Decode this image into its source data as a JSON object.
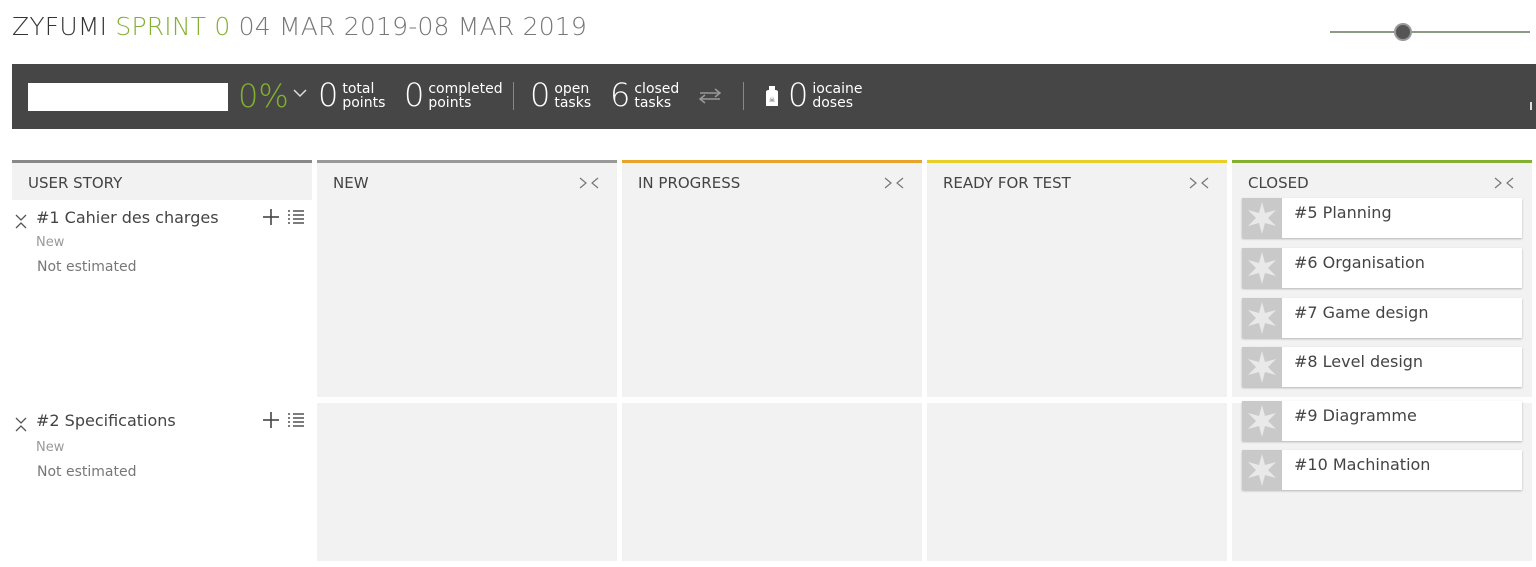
{
  "header": {
    "project": "ZYFUMI",
    "sprint": "SPRINT 0",
    "dates": "04 MAR 2019-08 MAR 2019"
  },
  "zoom": {
    "level": 0.35
  },
  "stats": {
    "progress": "0%",
    "total_points": {
      "value": "0",
      "label1": "total",
      "label2": "points"
    },
    "completed_points": {
      "value": "0",
      "label1": "completed",
      "label2": "points"
    },
    "open_tasks": {
      "value": "0",
      "label1": "open",
      "label2": "tasks"
    },
    "closed_tasks": {
      "value": "6",
      "label1": "closed",
      "label2": "tasks"
    },
    "iocaine_doses": {
      "value": "0",
      "label1": "iocaine",
      "label2": "doses"
    }
  },
  "columns": [
    {
      "title": "USER STORY",
      "color": "#888888"
    },
    {
      "title": "NEW",
      "color": "#999999"
    },
    {
      "title": "IN PROGRESS",
      "color": "#e8a42a"
    },
    {
      "title": "READY FOR TEST",
      "color": "#e7cf28"
    },
    {
      "title": "CLOSED",
      "color": "#83b02f"
    }
  ],
  "user_stories": [
    {
      "title": "#1 Cahier des charges",
      "status": "New",
      "estimation": "Not estimated",
      "closed_tasks": [
        "#5 Planning",
        "#6 Organisation",
        "#7 Game design",
        "#8 Level design"
      ]
    },
    {
      "title": "#2 Specifications",
      "status": "New",
      "estimation": "Not estimated",
      "closed_tasks": [
        "#9 Diagramme",
        "#10 Machination"
      ]
    }
  ]
}
